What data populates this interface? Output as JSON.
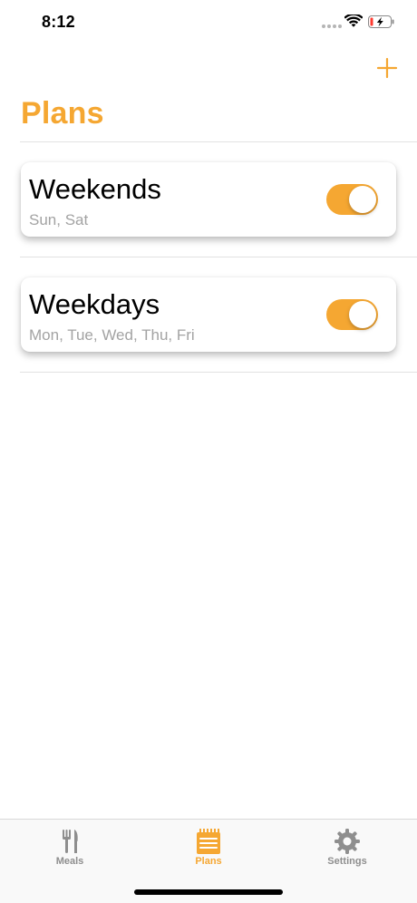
{
  "status_bar": {
    "time": "8:12"
  },
  "header": {
    "title": "Plans",
    "add_label": "+"
  },
  "plans": [
    {
      "name": "Weekends",
      "days": "Sun, Sat",
      "enabled": true
    },
    {
      "name": "Weekdays",
      "days": "Mon, Tue, Wed, Thu, Fri",
      "enabled": true
    }
  ],
  "tabs": [
    {
      "label": "Meals",
      "icon": "fork-knife-icon",
      "active": false
    },
    {
      "label": "Plans",
      "icon": "calendar-icon",
      "active": true
    },
    {
      "label": "Settings",
      "icon": "gear-icon",
      "active": false
    }
  ],
  "colors": {
    "accent": "#f5a732",
    "inactive": "#8e8e8e",
    "subtitle": "#a3a3a3"
  }
}
